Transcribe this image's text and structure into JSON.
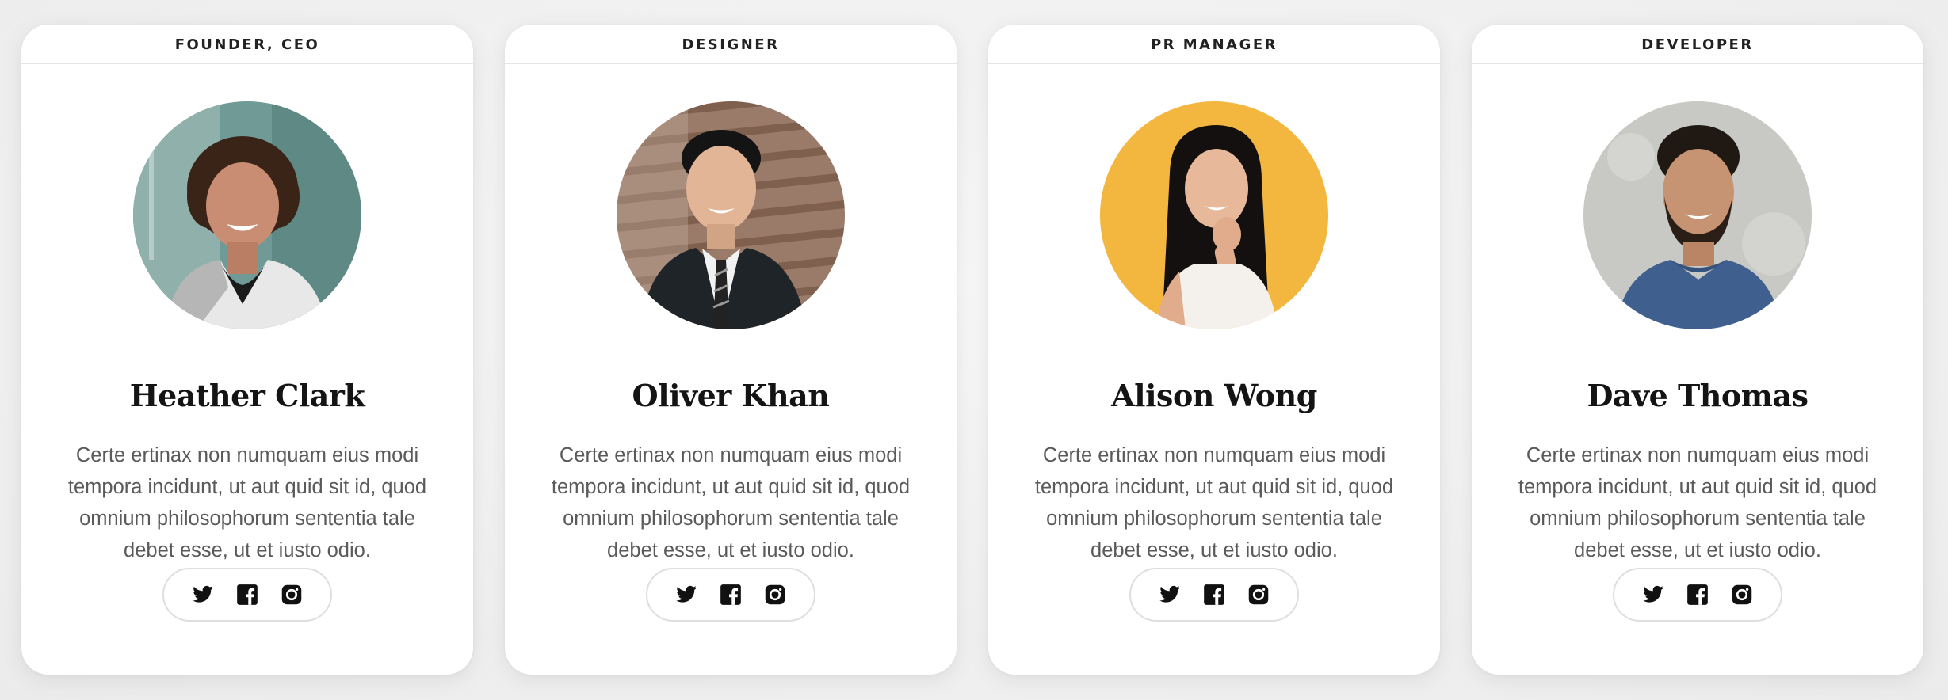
{
  "team": {
    "members": [
      {
        "role": "FOUNDER, CEO",
        "name": "Heather Clark",
        "bio": "Certe ertinax non numquam eius modi tempora incidunt, ut aut quid sit id, quod omnium philosophorum sententia tale debet esse, ut et iusto odio.",
        "avatar_bg": "#6f9a96"
      },
      {
        "role": "DESIGNER",
        "name": "Oliver Khan",
        "bio": "Certe ertinax non numquam eius modi tempora incidunt, ut aut quid sit id, quod omnium philosophorum sententia tale debet esse, ut et iusto odio.",
        "avatar_bg": "#9a7a68"
      },
      {
        "role": "PR MANAGER",
        "name": "Alison Wong",
        "bio": "Certe ertinax non numquam eius modi tempora incidunt, ut aut quid sit id, quod omnium philosophorum sententia tale debet esse, ut et iusto odio.",
        "avatar_bg": "#f3b63f"
      },
      {
        "role": "DEVELOPER",
        "name": "Dave Thomas",
        "bio": "Certe ertinax non numquam eius modi tempora incidunt, ut aut quid sit id, quod omnium philosophorum sententia tale debet esse, ut et iusto odio.",
        "avatar_bg": "#cfcfcd"
      }
    ],
    "social_icons": [
      "twitter-icon",
      "facebook-icon",
      "instagram-icon"
    ]
  },
  "colors": {
    "page_background": "#efefef",
    "card_background": "#ffffff",
    "name_text": "#141414",
    "bio_text": "#5a5a5a",
    "divider": "#e5e5e5"
  }
}
